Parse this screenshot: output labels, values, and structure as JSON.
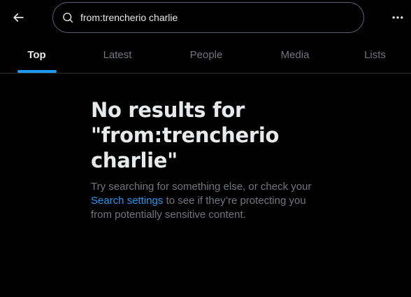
{
  "header": {
    "search_value": "from:trencherio charlie",
    "back_icon": "arrow-left-icon",
    "search_icon": "magnifier-icon",
    "more_icon": "ellipsis-horizontal-icon"
  },
  "tabs": [
    {
      "label": "Top",
      "active": true
    },
    {
      "label": "Latest",
      "active": false
    },
    {
      "label": "People",
      "active": false
    },
    {
      "label": "Media",
      "active": false
    },
    {
      "label": "Lists",
      "active": false
    }
  ],
  "empty_state": {
    "title_line1": "No results for",
    "title_line2": "\"from:trencherio",
    "title_line3": "charlie\"",
    "body_before": "Try searching for something else, or check your",
    "link_text": "Search settings",
    "body_after": "to see if they’re protecting you from potentially sensitive content."
  },
  "colors": {
    "background": "#000000",
    "text_primary": "#e7e9ea",
    "text_secondary": "#71767b",
    "accent": "#1d9bf0",
    "border": "#2f3336"
  }
}
